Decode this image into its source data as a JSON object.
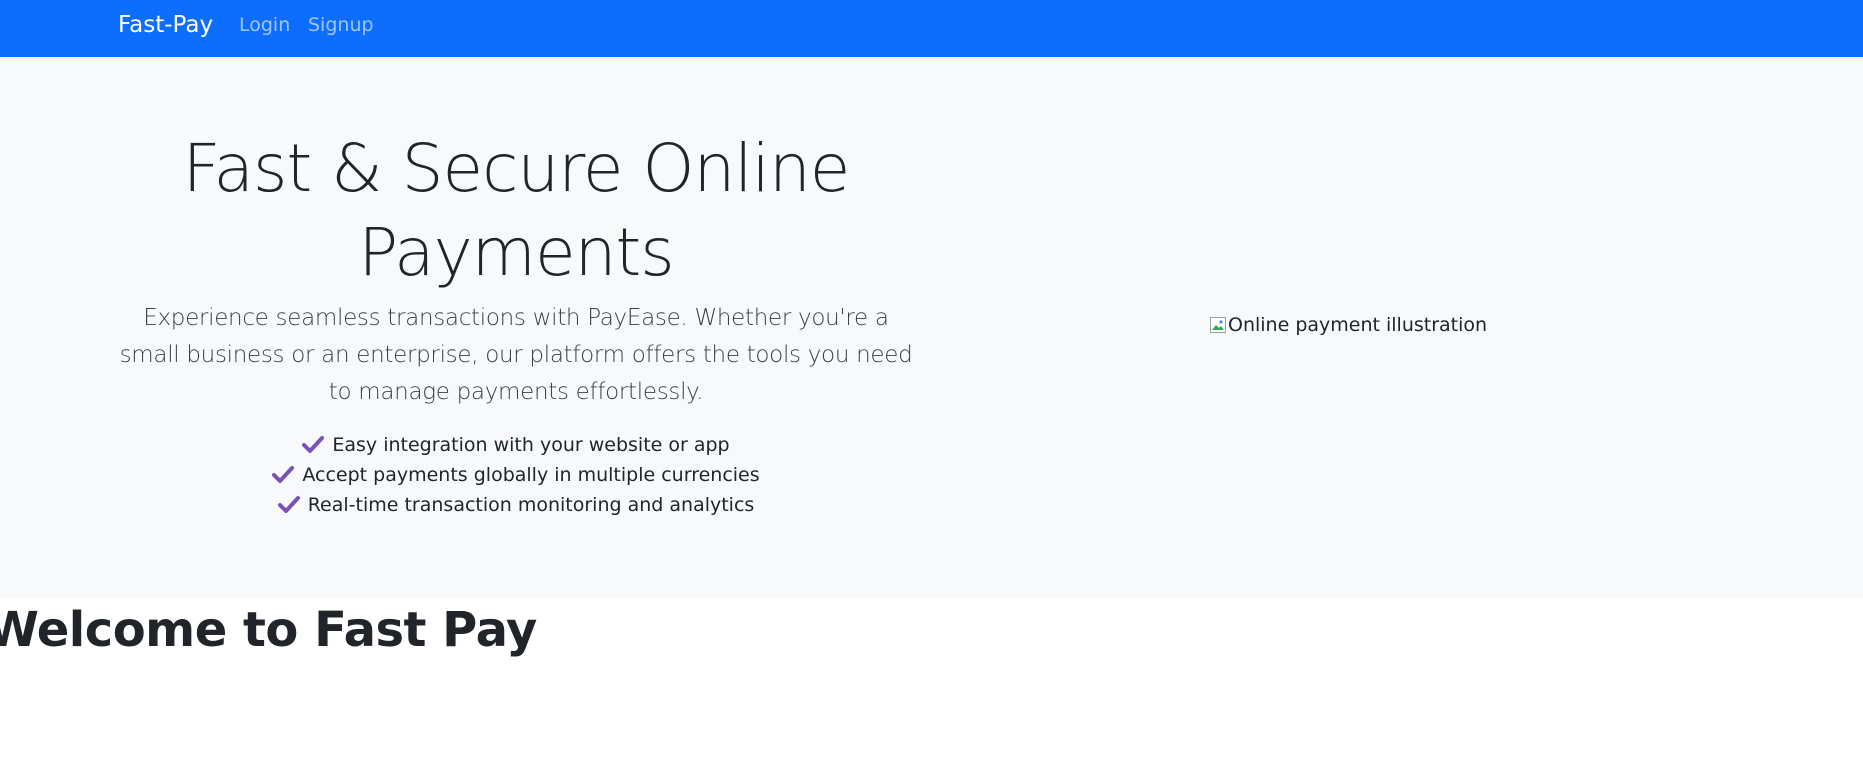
{
  "navbar": {
    "brand": "Fast-Pay",
    "links": [
      {
        "label": "Login"
      },
      {
        "label": "Signup"
      }
    ]
  },
  "hero": {
    "title": "Fast & Secure Online Payments",
    "lead": "Experience seamless transactions with PayEase. Whether you're a small business or an enterprise, our platform offers the tools you need to manage payments effortlessly.",
    "features": [
      "Easy integration with your website or app",
      "Accept payments globally in multiple currencies",
      "Real-time transaction monitoring and analytics"
    ],
    "image_alt": "Online payment illustration"
  },
  "welcome": {
    "heading": "Welcome to Fast Pay"
  },
  "colors": {
    "navbar_bg": "#0d6efd",
    "hero_bg": "#f8f9fa",
    "check_color": "#7952b3"
  },
  "icons": {
    "feature_icon": "check-icon",
    "image_icon": "broken-image-icon"
  }
}
